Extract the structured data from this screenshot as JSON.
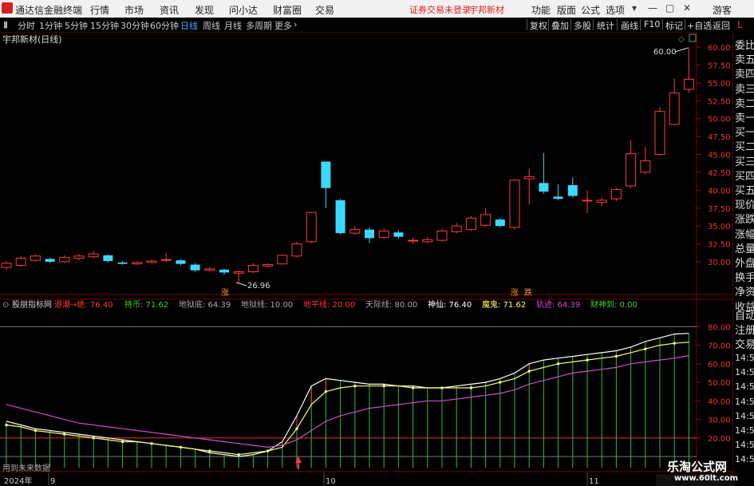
{
  "app": {
    "name": "通达信金融终端"
  },
  "menu": [
    "行情",
    "市场",
    "资讯",
    "发现",
    "问小达",
    "财富圈",
    "交易"
  ],
  "notice": "证券交易未登录",
  "stock_name": "宇邦新材",
  "right_menu": [
    "功能",
    "版面",
    "公式",
    "选项"
  ],
  "guest": "游客",
  "periods": [
    "分时",
    "1分钟",
    "5分钟",
    "15分钟",
    "30分钟",
    "60分钟",
    "日线",
    "周线",
    "月线",
    "多周期",
    "更多"
  ],
  "active_period": "日线",
  "right_toolbar": [
    "复权",
    "叠加",
    "多股",
    "统计",
    "画线",
    "F10",
    "标记",
    "+自选",
    "返回"
  ],
  "l_label": "L",
  "chart_title": "宇邦新材(日线)",
  "price_axis": [
    "60.00",
    "57.50",
    "55.00",
    "52.50",
    "50.00",
    "47.50",
    "45.00",
    "42.50",
    "40.00",
    "37.50",
    "35.00",
    "32.50",
    "30.00"
  ],
  "high_label": "60.00",
  "low_label": "26.96",
  "tags": {
    "a": "涨",
    "b": "跌"
  },
  "indicator": {
    "name": "股朋指标网",
    "items": [
      {
        "label": "退潮→绝:",
        "value": "76.40",
        "color": "#ff3b3b"
      },
      {
        "label": "持币:",
        "value": "71.62",
        "color": "#3bd13b"
      },
      {
        "label": "地狱底:",
        "value": "64.39",
        "color": "#aaaaaa"
      },
      {
        "label": "地狱线:",
        "value": "10.00",
        "color": "#aaaaaa"
      },
      {
        "label": "地平线:",
        "value": "20.00",
        "color": "#ff3b3b"
      },
      {
        "label": "天际线:",
        "value": "80.00",
        "color": "#aaaaaa"
      },
      {
        "label": "神仙:",
        "value": "76.40",
        "color": "#ffffff"
      },
      {
        "label": "魔鬼:",
        "value": "71.62",
        "color": "#ffff66"
      },
      {
        "label": "轨迹:",
        "value": "64.39",
        "color": "#d24bd2"
      },
      {
        "label": "财神到:",
        "value": "0.00",
        "color": "#3bd13b"
      }
    ]
  },
  "ind_axis": [
    "80.00",
    "70.00",
    "60.00",
    "50.00",
    "40.00",
    "30.00",
    "20.00"
  ],
  "future_note": "用到未来数据",
  "date_labels": [
    "2024年",
    "9",
    "10",
    "11"
  ],
  "right_panel": [
    "委比",
    "卖五",
    "卖四",
    "卖三",
    "卖二",
    "卖一",
    "买一",
    "买二",
    "买三",
    "买四",
    "买五",
    "现价",
    "涨跌",
    "涨幅",
    "总量",
    "外盘",
    "换手",
    "净资",
    "收益",
    "自动",
    "注册",
    "交易",
    "14:56",
    "14:56",
    "14:56",
    "14:56",
    "14:56",
    "14:56",
    "14:56",
    "14:56"
  ],
  "watermark": {
    "line1": "乐淘公式网",
    "line2": "www.60lt.com"
  },
  "colors": {
    "up": "#ff3b3b",
    "down": "#3bd8ff",
    "ma": "#ffffff"
  },
  "chart_data": {
    "type": "candlestick",
    "ylim": [
      26.96,
      60.0
    ],
    "candles": [
      {
        "o": 29.2,
        "c": 29.8,
        "h": 30.1,
        "l": 28.9
      },
      {
        "o": 29.5,
        "c": 30.5,
        "h": 30.8,
        "l": 29.3
      },
      {
        "o": 30.2,
        "c": 30.8,
        "h": 31.0,
        "l": 30.0
      },
      {
        "o": 30.4,
        "c": 30.0,
        "h": 30.6,
        "l": 29.8
      },
      {
        "o": 30.0,
        "c": 30.6,
        "h": 30.9,
        "l": 29.9
      },
      {
        "o": 30.5,
        "c": 30.8,
        "h": 31.1,
        "l": 30.2
      },
      {
        "o": 30.7,
        "c": 31.1,
        "h": 31.4,
        "l": 30.5
      },
      {
        "o": 30.9,
        "c": 30.1,
        "h": 31.0,
        "l": 29.9
      },
      {
        "o": 29.9,
        "c": 29.7,
        "h": 30.1,
        "l": 29.6
      },
      {
        "o": 29.7,
        "c": 29.9,
        "h": 30.0,
        "l": 29.6
      },
      {
        "o": 29.9,
        "c": 30.1,
        "h": 30.3,
        "l": 29.8
      },
      {
        "o": 30.3,
        "c": 30.3,
        "h": 31.2,
        "l": 30.0
      },
      {
        "o": 30.2,
        "c": 29.7,
        "h": 30.4,
        "l": 29.5
      },
      {
        "o": 29.6,
        "c": 28.8,
        "h": 29.8,
        "l": 28.6
      },
      {
        "o": 28.8,
        "c": 29.0,
        "h": 29.3,
        "l": 28.6
      },
      {
        "o": 28.9,
        "c": 28.5,
        "h": 29.0,
        "l": 28.2
      },
      {
        "o": 28.4,
        "c": 28.6,
        "h": 28.8,
        "l": 26.96
      },
      {
        "o": 28.6,
        "c": 29.5,
        "h": 29.8,
        "l": 28.4
      },
      {
        "o": 29.4,
        "c": 29.6,
        "h": 29.8,
        "l": 29.2
      },
      {
        "o": 29.7,
        "c": 30.9,
        "h": 31.0,
        "l": 29.6
      },
      {
        "o": 30.8,
        "c": 32.5,
        "h": 32.8,
        "l": 30.6
      },
      {
        "o": 32.8,
        "c": 36.9,
        "h": 37.0,
        "l": 32.6
      },
      {
        "o": 44.0,
        "c": 40.3,
        "h": 44.0,
        "l": 37.5
      },
      {
        "o": 38.6,
        "c": 34.0,
        "h": 38.8,
        "l": 33.8
      },
      {
        "o": 34.0,
        "c": 34.5,
        "h": 35.0,
        "l": 33.8
      },
      {
        "o": 34.5,
        "c": 33.3,
        "h": 34.8,
        "l": 32.6
      },
      {
        "o": 33.4,
        "c": 34.3,
        "h": 34.7,
        "l": 33.2
      },
      {
        "o": 34.1,
        "c": 33.5,
        "h": 34.4,
        "l": 33.2
      },
      {
        "o": 32.9,
        "c": 33.0,
        "h": 33.4,
        "l": 32.5
      },
      {
        "o": 32.8,
        "c": 33.1,
        "h": 33.5,
        "l": 32.6
      },
      {
        "o": 33.0,
        "c": 34.3,
        "h": 34.6,
        "l": 32.8
      },
      {
        "o": 34.2,
        "c": 35.0,
        "h": 35.4,
        "l": 34.0
      },
      {
        "o": 34.5,
        "c": 36.1,
        "h": 36.4,
        "l": 34.3
      },
      {
        "o": 35.1,
        "c": 36.6,
        "h": 37.5,
        "l": 34.9
      },
      {
        "o": 35.9,
        "c": 35.0,
        "h": 36.1,
        "l": 34.8
      },
      {
        "o": 34.8,
        "c": 41.4,
        "h": 41.6,
        "l": 34.5
      },
      {
        "o": 41.6,
        "c": 41.9,
        "h": 43.0,
        "l": 38.0
      },
      {
        "o": 41.0,
        "c": 39.8,
        "h": 45.2,
        "l": 39.5
      },
      {
        "o": 39.1,
        "c": 38.8,
        "h": 40.8,
        "l": 38.6
      },
      {
        "o": 40.7,
        "c": 39.2,
        "h": 41.8,
        "l": 39.0
      },
      {
        "o": 38.6,
        "c": 38.6,
        "h": 40.0,
        "l": 36.8
      },
      {
        "o": 38.3,
        "c": 38.6,
        "h": 39.0,
        "l": 37.8
      },
      {
        "o": 38.8,
        "c": 40.1,
        "h": 40.3,
        "l": 38.5
      },
      {
        "o": 40.6,
        "c": 45.1,
        "h": 47.0,
        "l": 40.3
      },
      {
        "o": 42.5,
        "c": 44.1,
        "h": 46.0,
        "l": 42.2
      },
      {
        "o": 45.0,
        "c": 51.0,
        "h": 51.6,
        "l": 44.8
      },
      {
        "o": 49.2,
        "c": 53.6,
        "h": 55.6,
        "l": 49.0
      },
      {
        "o": 54.1,
        "c": 55.5,
        "h": 60.0,
        "l": 53.6
      }
    ],
    "series": [
      {
        "name": "神仙",
        "color": "#ffffff",
        "values": [
          29,
          27,
          25,
          24,
          23,
          22,
          21,
          20,
          19,
          18,
          17,
          16,
          15,
          14,
          12,
          11,
          10,
          11,
          13,
          18,
          32,
          48,
          52,
          51,
          50,
          49,
          49,
          48,
          48,
          47,
          47,
          48,
          49,
          50,
          52,
          55,
          60,
          62,
          63,
          64,
          65,
          66,
          67,
          69,
          72,
          74,
          76,
          76.4
        ]
      },
      {
        "name": "魔鬼",
        "color": "#ffff66",
        "values": [
          27,
          26,
          24,
          23,
          22,
          21,
          20,
          19,
          18,
          18,
          17,
          16,
          15,
          14,
          13,
          12,
          11,
          12,
          13,
          15,
          25,
          38,
          45,
          47,
          48,
          48,
          48,
          48,
          47,
          47,
          47,
          47,
          47,
          48,
          50,
          52,
          56,
          58,
          60,
          61,
          62,
          63,
          64,
          66,
          68,
          70,
          71,
          71.6
        ]
      },
      {
        "name": "轨迹",
        "color": "#d24bd2",
        "values": [
          38,
          36,
          34,
          32,
          30,
          28,
          27,
          26,
          25,
          24,
          23,
          22,
          21,
          20,
          19,
          18,
          17,
          16,
          15,
          16,
          19,
          24,
          29,
          32,
          34,
          36,
          37,
          38,
          39,
          40,
          40,
          41,
          42,
          43,
          44,
          46,
          49,
          51,
          53,
          55,
          56,
          57,
          58,
          60,
          61,
          62,
          63,
          64.4
        ]
      }
    ],
    "ind_ylim": [
      4,
      84
    ]
  }
}
